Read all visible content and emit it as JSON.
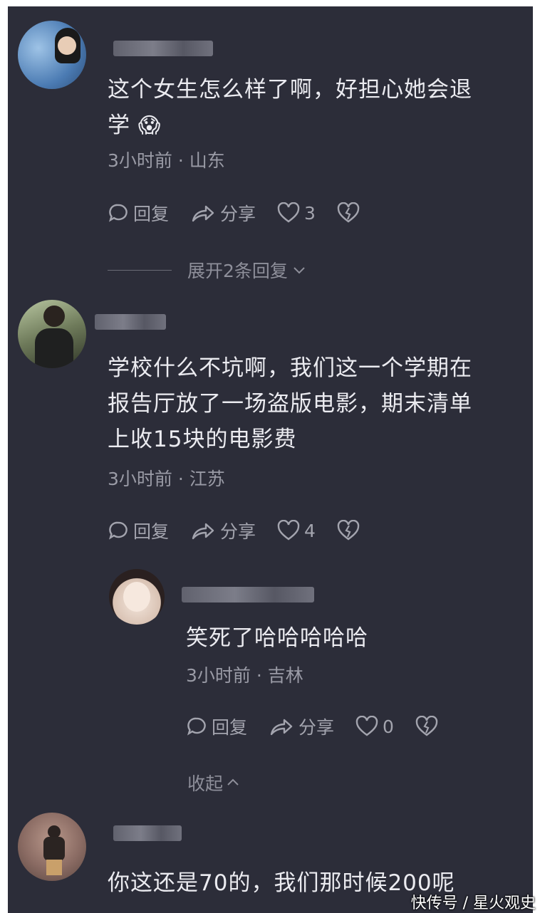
{
  "comments": [
    {
      "text_line1": "这个女生怎么样了啊，好担心她会退",
      "text_line2": "学",
      "emoji": "😱",
      "meta": "3小时前 · 山东",
      "reply_label": "回复",
      "share_label": "分享",
      "likes": "3",
      "expand_label": "展开2条回复"
    },
    {
      "text_line1": "学校什么不坑啊，我们这一个学期在",
      "text_line2": "报告厅放了一场盗版电影，期末清单",
      "text_line3": "上收15块的电影费",
      "meta": "3小时前 · 江苏",
      "reply_label": "回复",
      "share_label": "分享",
      "likes": "4",
      "reply": {
        "text": "笑死了哈哈哈哈哈",
        "meta": "3小时前 · 吉林",
        "reply_label": "回复",
        "share_label": "分享",
        "likes": "0",
        "collapse_label": "收起"
      }
    },
    {
      "text_line1": "你这还是70的，我们那时候200呢"
    }
  ],
  "watermark": "快传号 / 星火观史"
}
